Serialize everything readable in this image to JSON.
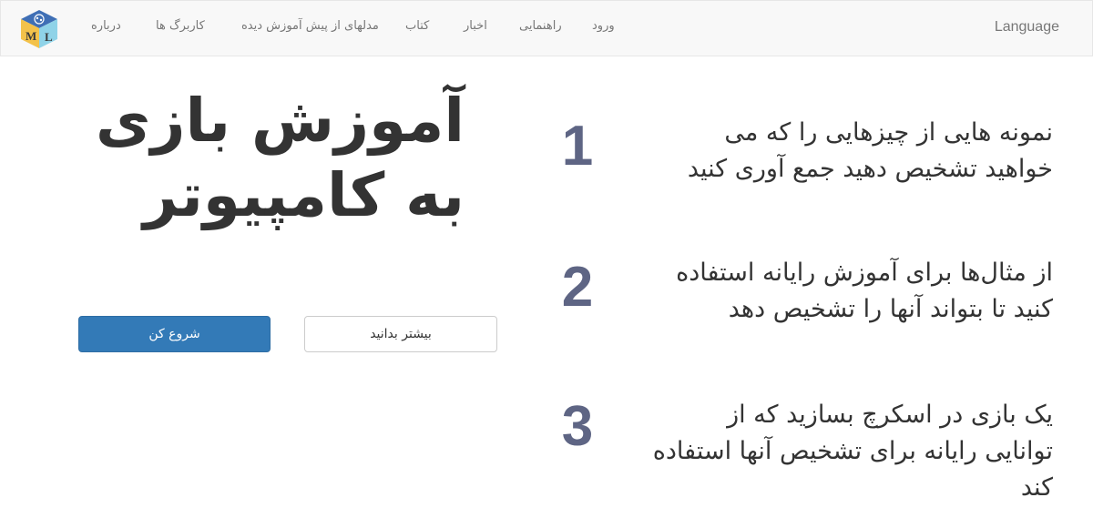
{
  "navbar": {
    "logo": {
      "icon": "ml-cube-logo",
      "letters": [
        "M",
        "L"
      ]
    },
    "items": [
      {
        "label": "درباره"
      },
      {
        "label": "کاربرگ ها"
      },
      {
        "label": "مدلهای از پیش آموزش دیده"
      },
      {
        "label": "کتاب"
      },
      {
        "label": "اخبار"
      },
      {
        "label": "راهنمایی"
      },
      {
        "label": "ورود"
      }
    ],
    "language_label": "Language"
  },
  "hero": {
    "title": "آموزش بازی به کامپیوتر",
    "start_button_label": "شروع کن",
    "learn_more_button_label": "بیشتر بدانید"
  },
  "steps": [
    {
      "number": "1",
      "text": "نمونه هایی از چیزهایی را که می خواهید تشخیص دهید جمع آوری کنید"
    },
    {
      "number": "2",
      "text": "از مثال‌ها برای آموزش رایانه استفاده کنید تا بتواند آنها را تشخیص دهد"
    },
    {
      "number": "3",
      "text": "یک بازی در اسکرچ بسازید که از توانایی رایانه برای تشخیص آنها استفاده کند"
    }
  ],
  "colors": {
    "primary": "#337ab7",
    "step_number": "#5e6584",
    "navbar_bg": "#f8f8f8"
  }
}
